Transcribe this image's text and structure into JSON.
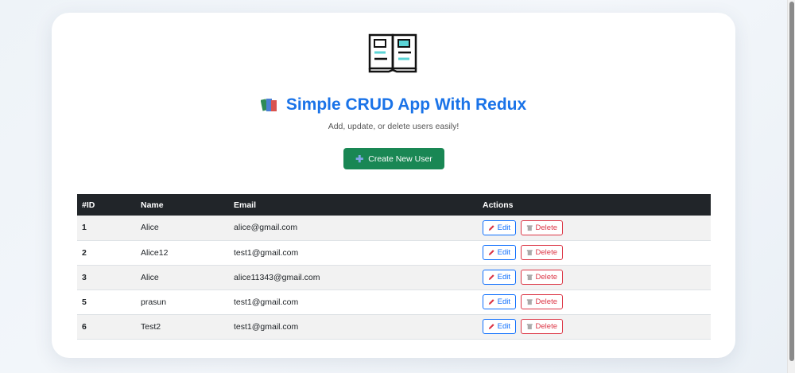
{
  "header": {
    "title": "Simple CRUD App With Redux",
    "subtitle": "Add, update, or delete users easily!"
  },
  "toolbar": {
    "create_label": "Create New User"
  },
  "table": {
    "columns": [
      "#ID",
      "Name",
      "Email",
      "Actions"
    ],
    "rows": [
      {
        "id": "1",
        "name": "Alice",
        "email": "alice@gmail.com"
      },
      {
        "id": "2",
        "name": "Alice12",
        "email": "test1@gmail.com"
      },
      {
        "id": "3",
        "name": "Alice",
        "email": "alice11343@gmail.com"
      },
      {
        "id": "5",
        "name": "prasun",
        "email": "test1@gmail.com"
      },
      {
        "id": "6",
        "name": "Test2",
        "email": "test1@gmail.com"
      }
    ],
    "edit_label": "Edit",
    "delete_label": "Delete"
  },
  "icons": {
    "logo": "open-book-icon",
    "title": "books-icon",
    "create": "plus-icon",
    "edit": "pencil-icon",
    "delete": "trash-icon"
  },
  "colors": {
    "title": "#1a73e8",
    "create_button": "#198754",
    "table_header": "#212529",
    "edit": "#0d6efd",
    "delete": "#dc3545"
  }
}
